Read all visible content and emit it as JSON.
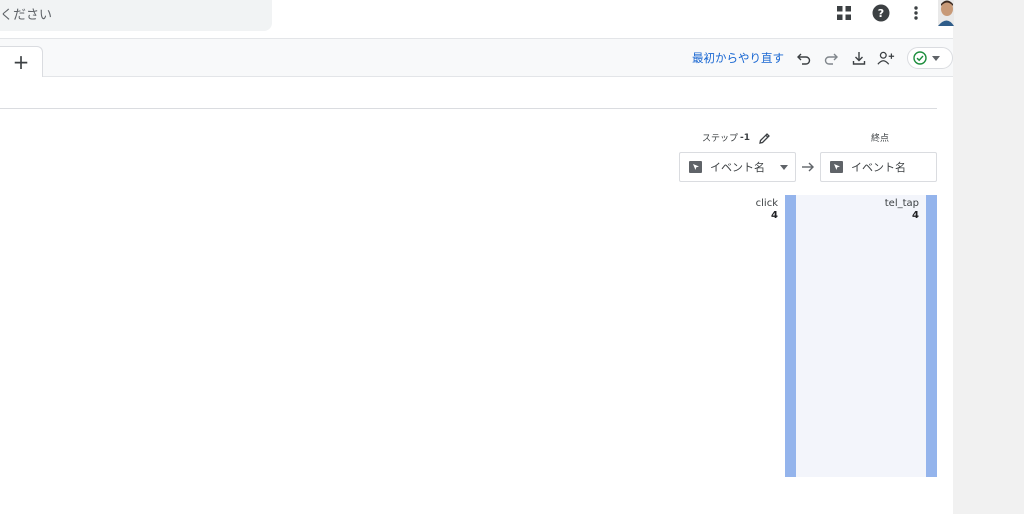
{
  "search": {
    "placeholder": "ください"
  },
  "topbar": {
    "icons": [
      "apps-grid-icon",
      "help-icon",
      "more-vert-icon"
    ],
    "avatar": "user-avatar"
  },
  "tabbar": {
    "add_tab_label": "+",
    "restart_label": "最初からやり直す",
    "tools": [
      "undo-icon",
      "redo-icon",
      "download-icon",
      "share-user-icon",
      "check-circle-icon"
    ],
    "accent_color": "#1967d2",
    "status_color": "#1e8e3e"
  },
  "funnel": {
    "step": {
      "header_label": "ステップ",
      "header_number": "-1",
      "dropdown_label": "イベント名",
      "event": "click",
      "count": "4"
    },
    "end": {
      "header_label": "終点",
      "dropdown_label": "イベント名",
      "event": "tel_tap",
      "count": "4"
    },
    "bar_color": "#94b4ec"
  }
}
